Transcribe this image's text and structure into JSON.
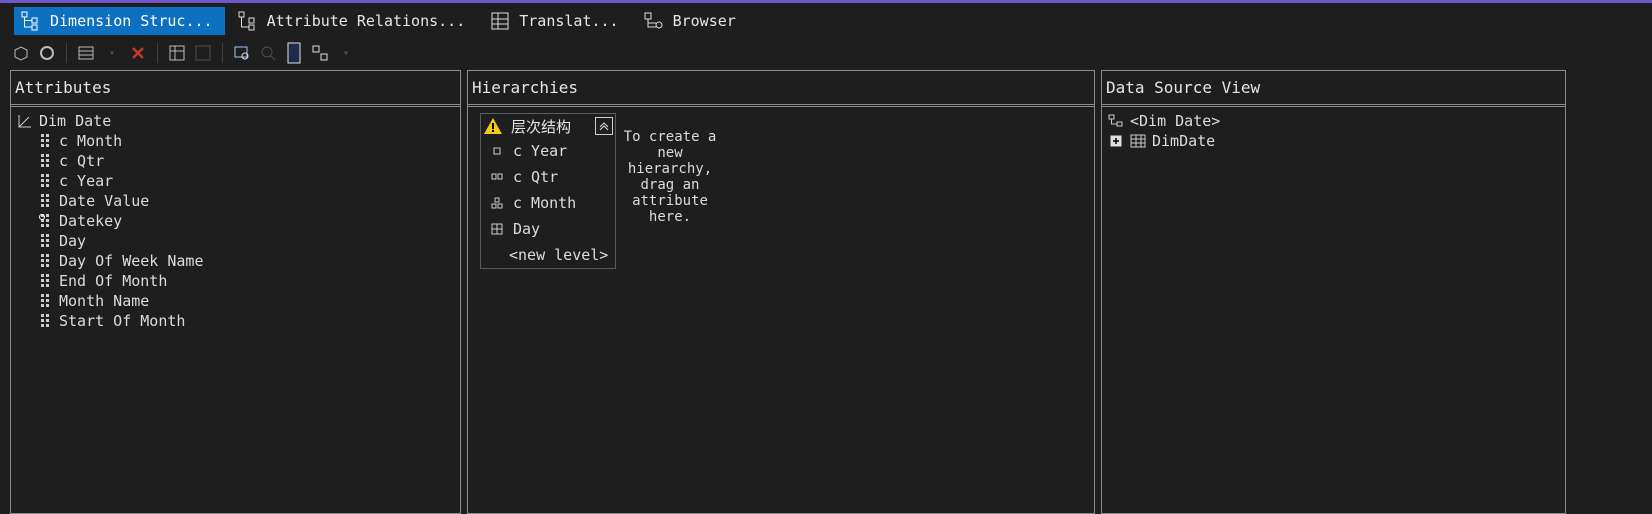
{
  "tabs": [
    {
      "label": "Dimension Struc...",
      "active": true,
      "icon": "dimension-structure-icon"
    },
    {
      "label": "Attribute Relations...",
      "active": false,
      "icon": "attribute-relationships-icon"
    },
    {
      "label": "Translat...",
      "active": false,
      "icon": "translations-icon"
    },
    {
      "label": "Browser",
      "active": false,
      "icon": "browser-icon"
    }
  ],
  "panels": {
    "attributes": {
      "title": "Attributes",
      "dimension": "Dim Date",
      "items": [
        "c Month",
        "c Qtr",
        "c Year",
        "Date Value",
        "Datekey",
        "Day",
        "Day Of Week Name",
        "End Of Month",
        "Month Name",
        "Start Of Month"
      ]
    },
    "hierarchies": {
      "title": "Hierarchies",
      "hierarchy_name": "层次结构",
      "levels": [
        "c Year",
        "c Qtr",
        "c Month",
        "Day"
      ],
      "new_level": "<new level>",
      "hint_lines": [
        "To create a",
        "new",
        "hierarchy,",
        "drag an",
        "attribute",
        "here."
      ]
    },
    "dsv": {
      "title": "Data Source View",
      "root": "<Dim Date>",
      "table": "DimDate"
    }
  },
  "colors": {
    "accent": "#0e70c0",
    "top_line": "#6e57c8",
    "background": "#1e1e1e",
    "warning": "#f2c811"
  }
}
